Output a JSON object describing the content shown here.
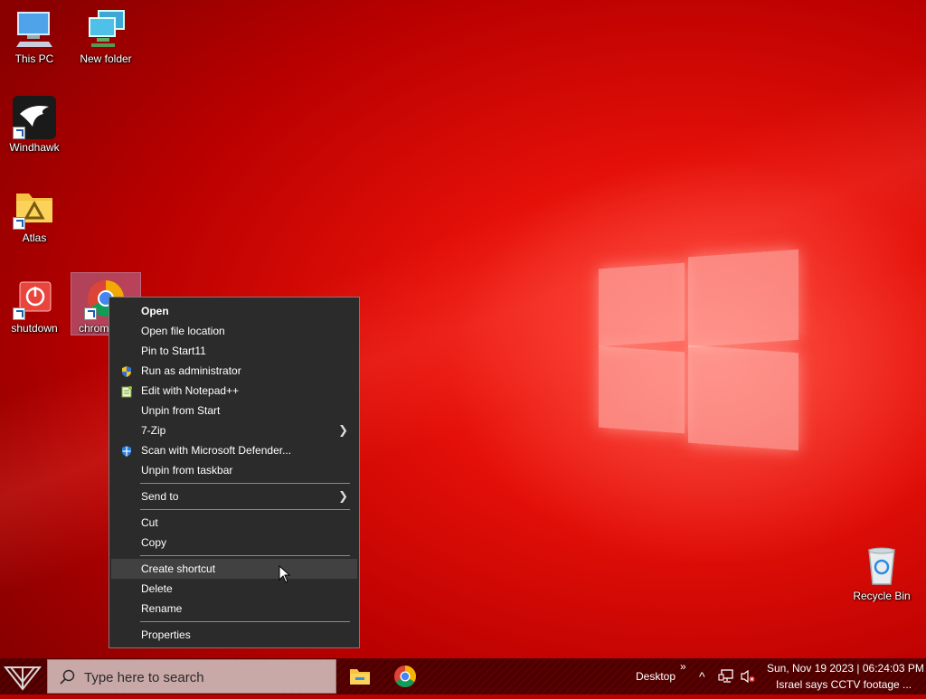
{
  "desktop": {
    "icons": [
      {
        "label": "This PC"
      },
      {
        "label": "New folder"
      },
      {
        "label": "Windhawk"
      },
      {
        "label": "Atlas"
      },
      {
        "label": "shutdown"
      },
      {
        "label": "chrom"
      },
      {
        "label": "Recycle Bin"
      }
    ]
  },
  "context_menu": {
    "items": [
      {
        "label": "Open",
        "icon": ""
      },
      {
        "label": "Open file location",
        "icon": ""
      },
      {
        "label": "Pin to Start11",
        "icon": ""
      },
      {
        "label": "Run as administrator",
        "icon": "uac-shield-icon"
      },
      {
        "label": "Edit with Notepad++",
        "icon": "notepadpp-icon"
      },
      {
        "label": "Unpin from Start",
        "icon": ""
      },
      {
        "label": "7-Zip",
        "icon": "",
        "submenu": true
      },
      {
        "label": "Scan with Microsoft Defender...",
        "icon": "defender-shield-icon"
      },
      {
        "label": "Unpin from taskbar",
        "icon": ""
      },
      {
        "label": "Send to",
        "icon": "",
        "submenu": true
      },
      {
        "label": "Cut",
        "icon": ""
      },
      {
        "label": "Copy",
        "icon": ""
      },
      {
        "label": "Create shortcut",
        "icon": "",
        "highlighted": true
      },
      {
        "label": "Delete",
        "icon": ""
      },
      {
        "label": "Rename",
        "icon": ""
      },
      {
        "label": "Properties",
        "icon": ""
      }
    ]
  },
  "taskbar": {
    "search_placeholder": "Type here to search",
    "desktop_label": "Desktop",
    "chevron": "»",
    "tray_up": "^",
    "clock_line1": "Sun, Nov 19 2023 | 06:24:03 PM",
    "clock_line2": "Israel says CCTV footage ..."
  },
  "colors": {
    "accent": "#e01010",
    "menu_bg": "#2b2b2b",
    "menu_hover": "#414141"
  }
}
